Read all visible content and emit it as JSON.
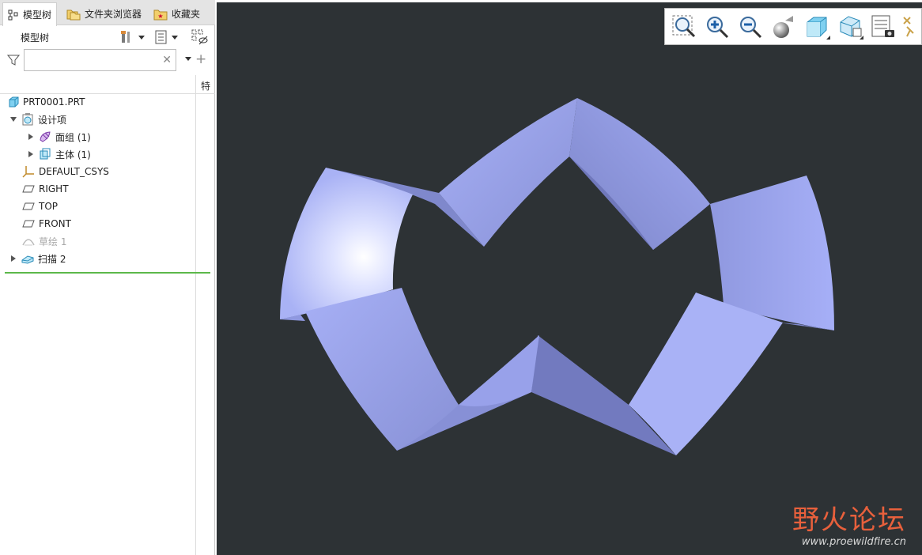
{
  "tabs": [
    {
      "label": "模型树",
      "icon": "model-tree-icon",
      "active": true
    },
    {
      "label": "文件夹浏览器",
      "icon": "folder-browser-icon",
      "active": false
    },
    {
      "label": "收藏夹",
      "icon": "favorites-icon",
      "active": false
    }
  ],
  "tree_panel": {
    "title": "模型树",
    "search": {
      "value": "",
      "placeholder": ""
    },
    "column_header": "特"
  },
  "tree": [
    {
      "label": "PRT0001.PRT",
      "icon": "part-icon",
      "expander": "none",
      "level": 0,
      "dim": false
    },
    {
      "label": "设计项",
      "icon": "design-items-icon",
      "expander": "expanded",
      "level": 0,
      "dim": false
    },
    {
      "label": "面组 (1)",
      "icon": "quilt-icon",
      "expander": "collapsed",
      "level": 1,
      "dim": false
    },
    {
      "label": "主体 (1)",
      "icon": "body-icon",
      "expander": "collapsed",
      "level": 1,
      "dim": false
    },
    {
      "label": "DEFAULT_CSYS",
      "icon": "csys-icon",
      "expander": "none",
      "level": 0,
      "dim": false
    },
    {
      "label": "RIGHT",
      "icon": "datum-plane-icon",
      "expander": "none",
      "level": 0,
      "dim": false
    },
    {
      "label": "TOP",
      "icon": "datum-plane-icon",
      "expander": "none",
      "level": 0,
      "dim": false
    },
    {
      "label": "FRONT",
      "icon": "datum-plane-icon",
      "expander": "none",
      "level": 0,
      "dim": false
    },
    {
      "label": "草绘 1",
      "icon": "sketch-icon",
      "expander": "none",
      "level": 0,
      "dim": true
    },
    {
      "label": "扫描 2",
      "icon": "sweep-icon",
      "expander": "collapsed",
      "level": 0,
      "dim": false
    }
  ],
  "view_toolbar": [
    "refit-icon",
    "zoom-in-icon",
    "zoom-out-icon",
    "repaint-icon",
    "display-style-icon",
    "saved-views-icon",
    "view-manager-icon",
    "more-icon"
  ],
  "watermark": {
    "title": "野火论坛",
    "url": "www.proewildfire.cn"
  },
  "colors": {
    "viewport_bg": "#2d3235",
    "surface": "#9fa8f2",
    "accent_green": "#5cb84a",
    "watermark": "#e8603c"
  }
}
